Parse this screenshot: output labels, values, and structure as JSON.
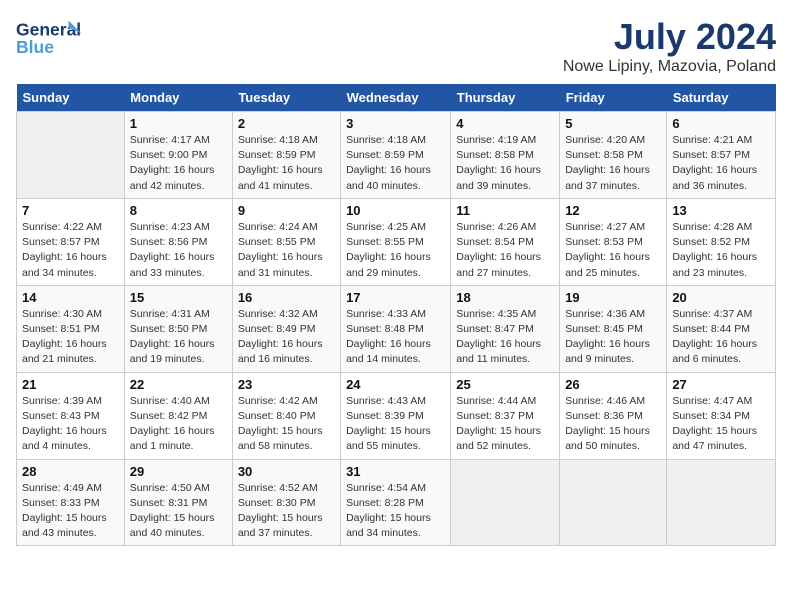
{
  "header": {
    "logo_general": "General",
    "logo_blue": "Blue",
    "month": "July 2024",
    "location": "Nowe Lipiny, Mazovia, Poland"
  },
  "days_of_week": [
    "Sunday",
    "Monday",
    "Tuesday",
    "Wednesday",
    "Thursday",
    "Friday",
    "Saturday"
  ],
  "weeks": [
    [
      {
        "day": "",
        "info": ""
      },
      {
        "day": "1",
        "info": "Sunrise: 4:17 AM\nSunset: 9:00 PM\nDaylight: 16 hours\nand 42 minutes."
      },
      {
        "day": "2",
        "info": "Sunrise: 4:18 AM\nSunset: 8:59 PM\nDaylight: 16 hours\nand 41 minutes."
      },
      {
        "day": "3",
        "info": "Sunrise: 4:18 AM\nSunset: 8:59 PM\nDaylight: 16 hours\nand 40 minutes."
      },
      {
        "day": "4",
        "info": "Sunrise: 4:19 AM\nSunset: 8:58 PM\nDaylight: 16 hours\nand 39 minutes."
      },
      {
        "day": "5",
        "info": "Sunrise: 4:20 AM\nSunset: 8:58 PM\nDaylight: 16 hours\nand 37 minutes."
      },
      {
        "day": "6",
        "info": "Sunrise: 4:21 AM\nSunset: 8:57 PM\nDaylight: 16 hours\nand 36 minutes."
      }
    ],
    [
      {
        "day": "7",
        "info": "Sunrise: 4:22 AM\nSunset: 8:57 PM\nDaylight: 16 hours\nand 34 minutes."
      },
      {
        "day": "8",
        "info": "Sunrise: 4:23 AM\nSunset: 8:56 PM\nDaylight: 16 hours\nand 33 minutes."
      },
      {
        "day": "9",
        "info": "Sunrise: 4:24 AM\nSunset: 8:55 PM\nDaylight: 16 hours\nand 31 minutes."
      },
      {
        "day": "10",
        "info": "Sunrise: 4:25 AM\nSunset: 8:55 PM\nDaylight: 16 hours\nand 29 minutes."
      },
      {
        "day": "11",
        "info": "Sunrise: 4:26 AM\nSunset: 8:54 PM\nDaylight: 16 hours\nand 27 minutes."
      },
      {
        "day": "12",
        "info": "Sunrise: 4:27 AM\nSunset: 8:53 PM\nDaylight: 16 hours\nand 25 minutes."
      },
      {
        "day": "13",
        "info": "Sunrise: 4:28 AM\nSunset: 8:52 PM\nDaylight: 16 hours\nand 23 minutes."
      }
    ],
    [
      {
        "day": "14",
        "info": "Sunrise: 4:30 AM\nSunset: 8:51 PM\nDaylight: 16 hours\nand 21 minutes."
      },
      {
        "day": "15",
        "info": "Sunrise: 4:31 AM\nSunset: 8:50 PM\nDaylight: 16 hours\nand 19 minutes."
      },
      {
        "day": "16",
        "info": "Sunrise: 4:32 AM\nSunset: 8:49 PM\nDaylight: 16 hours\nand 16 minutes."
      },
      {
        "day": "17",
        "info": "Sunrise: 4:33 AM\nSunset: 8:48 PM\nDaylight: 16 hours\nand 14 minutes."
      },
      {
        "day": "18",
        "info": "Sunrise: 4:35 AM\nSunset: 8:47 PM\nDaylight: 16 hours\nand 11 minutes."
      },
      {
        "day": "19",
        "info": "Sunrise: 4:36 AM\nSunset: 8:45 PM\nDaylight: 16 hours\nand 9 minutes."
      },
      {
        "day": "20",
        "info": "Sunrise: 4:37 AM\nSunset: 8:44 PM\nDaylight: 16 hours\nand 6 minutes."
      }
    ],
    [
      {
        "day": "21",
        "info": "Sunrise: 4:39 AM\nSunset: 8:43 PM\nDaylight: 16 hours\nand 4 minutes."
      },
      {
        "day": "22",
        "info": "Sunrise: 4:40 AM\nSunset: 8:42 PM\nDaylight: 16 hours\nand 1 minute."
      },
      {
        "day": "23",
        "info": "Sunrise: 4:42 AM\nSunset: 8:40 PM\nDaylight: 15 hours\nand 58 minutes."
      },
      {
        "day": "24",
        "info": "Sunrise: 4:43 AM\nSunset: 8:39 PM\nDaylight: 15 hours\nand 55 minutes."
      },
      {
        "day": "25",
        "info": "Sunrise: 4:44 AM\nSunset: 8:37 PM\nDaylight: 15 hours\nand 52 minutes."
      },
      {
        "day": "26",
        "info": "Sunrise: 4:46 AM\nSunset: 8:36 PM\nDaylight: 15 hours\nand 50 minutes."
      },
      {
        "day": "27",
        "info": "Sunrise: 4:47 AM\nSunset: 8:34 PM\nDaylight: 15 hours\nand 47 minutes."
      }
    ],
    [
      {
        "day": "28",
        "info": "Sunrise: 4:49 AM\nSunset: 8:33 PM\nDaylight: 15 hours\nand 43 minutes."
      },
      {
        "day": "29",
        "info": "Sunrise: 4:50 AM\nSunset: 8:31 PM\nDaylight: 15 hours\nand 40 minutes."
      },
      {
        "day": "30",
        "info": "Sunrise: 4:52 AM\nSunset: 8:30 PM\nDaylight: 15 hours\nand 37 minutes."
      },
      {
        "day": "31",
        "info": "Sunrise: 4:54 AM\nSunset: 8:28 PM\nDaylight: 15 hours\nand 34 minutes."
      },
      {
        "day": "",
        "info": ""
      },
      {
        "day": "",
        "info": ""
      },
      {
        "day": "",
        "info": ""
      }
    ]
  ]
}
